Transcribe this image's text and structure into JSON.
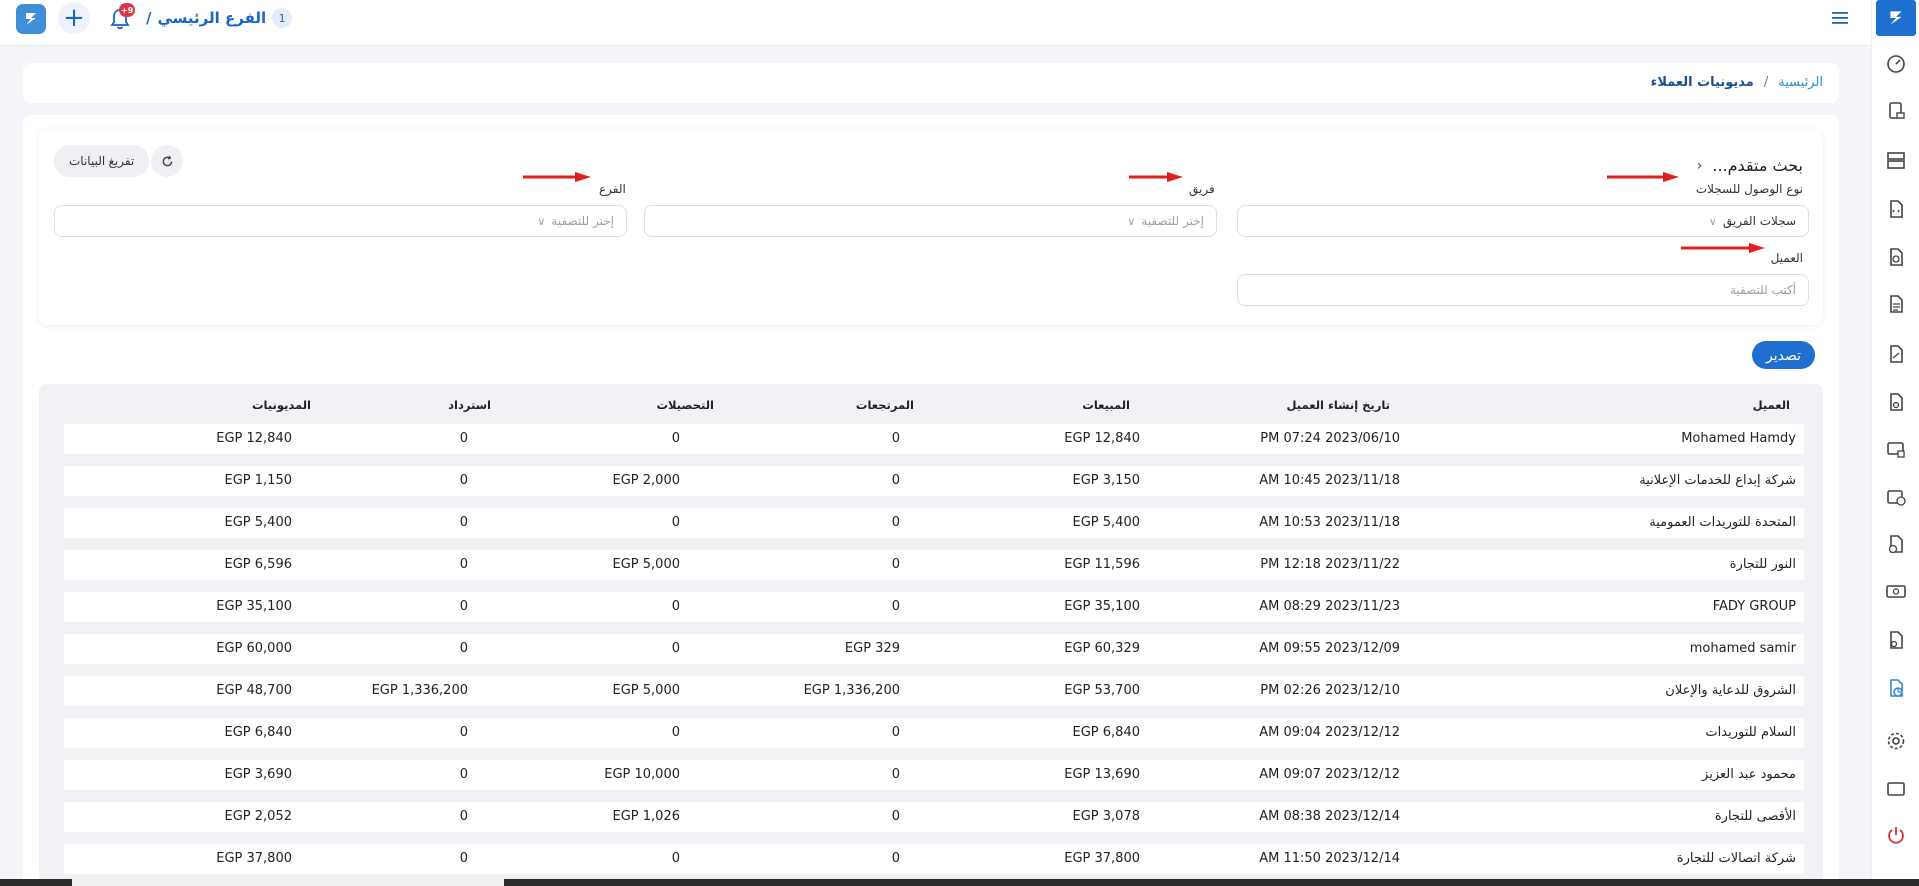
{
  "topbar": {
    "badge": "+9",
    "branch_separator": "/",
    "branch_name": "الفرع الرئيسي",
    "branch_number": "1"
  },
  "breadcrumb": {
    "home": "الرئيسية",
    "separator": "/",
    "current": "مديونيات العملاء"
  },
  "filters": {
    "title": "بحث متقدم...",
    "clear_label": "تفريغ البيانات",
    "access_type_label": "نوع الوصول للسجلات",
    "access_type_value": "سجلات الفريق",
    "team_label": "فريق",
    "team_placeholder": "إختر للتصفية",
    "branch_label": "الفرع",
    "branch_placeholder": "إختر للتصفية",
    "customer_label": "العميل",
    "customer_placeholder": "أكتب للتصفية"
  },
  "export_label": "تصدير",
  "table": {
    "headers": {
      "customer": "العميل",
      "created": "تاريخ إنشاء العميل",
      "sales": "المبيعات",
      "returns": "المرتجعات",
      "collections": "التحصيلات",
      "refund": "استرداد",
      "debts": "المديونيات"
    },
    "rows": [
      {
        "customer": "Mohamed Hamdy",
        "created": "PM 07:24 2023/06/10",
        "sales": "EGP 12,840",
        "returns": "0",
        "collections": "0",
        "refund": "0",
        "debts": "EGP 12,840"
      },
      {
        "customer": "شركة إبداع للخدمات الإعلانية",
        "created": "AM 10:45 2023/11/18",
        "sales": "EGP 3,150",
        "returns": "0",
        "collections": "EGP 2,000",
        "refund": "0",
        "debts": "EGP 1,150"
      },
      {
        "customer": "المتحدة للتوريدات العمومية",
        "created": "AM 10:53 2023/11/18",
        "sales": "EGP 5,400",
        "returns": "0",
        "collections": "0",
        "refund": "0",
        "debts": "EGP 5,400"
      },
      {
        "customer": "النور للتجارة",
        "created": "PM 12:18 2023/11/22",
        "sales": "EGP 11,596",
        "returns": "0",
        "collections": "EGP 5,000",
        "refund": "0",
        "debts": "EGP 6,596"
      },
      {
        "customer": "FADY GROUP",
        "created": "AM 08:29 2023/11/23",
        "sales": "EGP 35,100",
        "returns": "0",
        "collections": "0",
        "refund": "0",
        "debts": "EGP 35,100"
      },
      {
        "customer": "mohamed samir",
        "created": "AM 09:55 2023/12/09",
        "sales": "EGP 60,329",
        "returns": "EGP 329",
        "collections": "0",
        "refund": "0",
        "debts": "EGP 60,000"
      },
      {
        "customer": "الشروق للدعاية والإعلان",
        "created": "PM 02:26 2023/12/10",
        "sales": "EGP 53,700",
        "returns": "EGP 1,336,200",
        "collections": "EGP 5,000",
        "refund": "EGP 1,336,200",
        "debts": "EGP 48,700"
      },
      {
        "customer": "السلام للتوريدات",
        "created": "AM 09:04 2023/12/12",
        "sales": "EGP 6,840",
        "returns": "0",
        "collections": "0",
        "refund": "0",
        "debts": "EGP 6,840"
      },
      {
        "customer": "محمود عبد العزيز",
        "created": "AM 09:07 2023/12/12",
        "sales": "EGP 13,690",
        "returns": "0",
        "collections": "EGP 10,000",
        "refund": "0",
        "debts": "EGP 3,690"
      },
      {
        "customer": "الأقصى للتجارة",
        "created": "AM 08:38 2023/12/14",
        "sales": "EGP 3,078",
        "returns": "0",
        "collections": "EGP 1,026",
        "refund": "0",
        "debts": "EGP 2,052"
      },
      {
        "customer": "شركة اتصالات للتجارة",
        "created": "AM 11:50 2023/12/14",
        "sales": "EGP 37,800",
        "returns": "0",
        "collections": "0",
        "refund": "0",
        "debts": "EGP 37,800"
      }
    ]
  },
  "icons": {
    "logo": "app-logo-icon",
    "add": "plus-icon",
    "notifications": "bell-icon",
    "menu": "hamburger-menu-icon",
    "refresh": "refresh-icon"
  },
  "colors": {
    "primary": "#1f6fcf",
    "link": "#2f8bd6",
    "badge": "#e1344b",
    "active_sidebar": "#2f8bd6",
    "power": "#d9373f"
  }
}
